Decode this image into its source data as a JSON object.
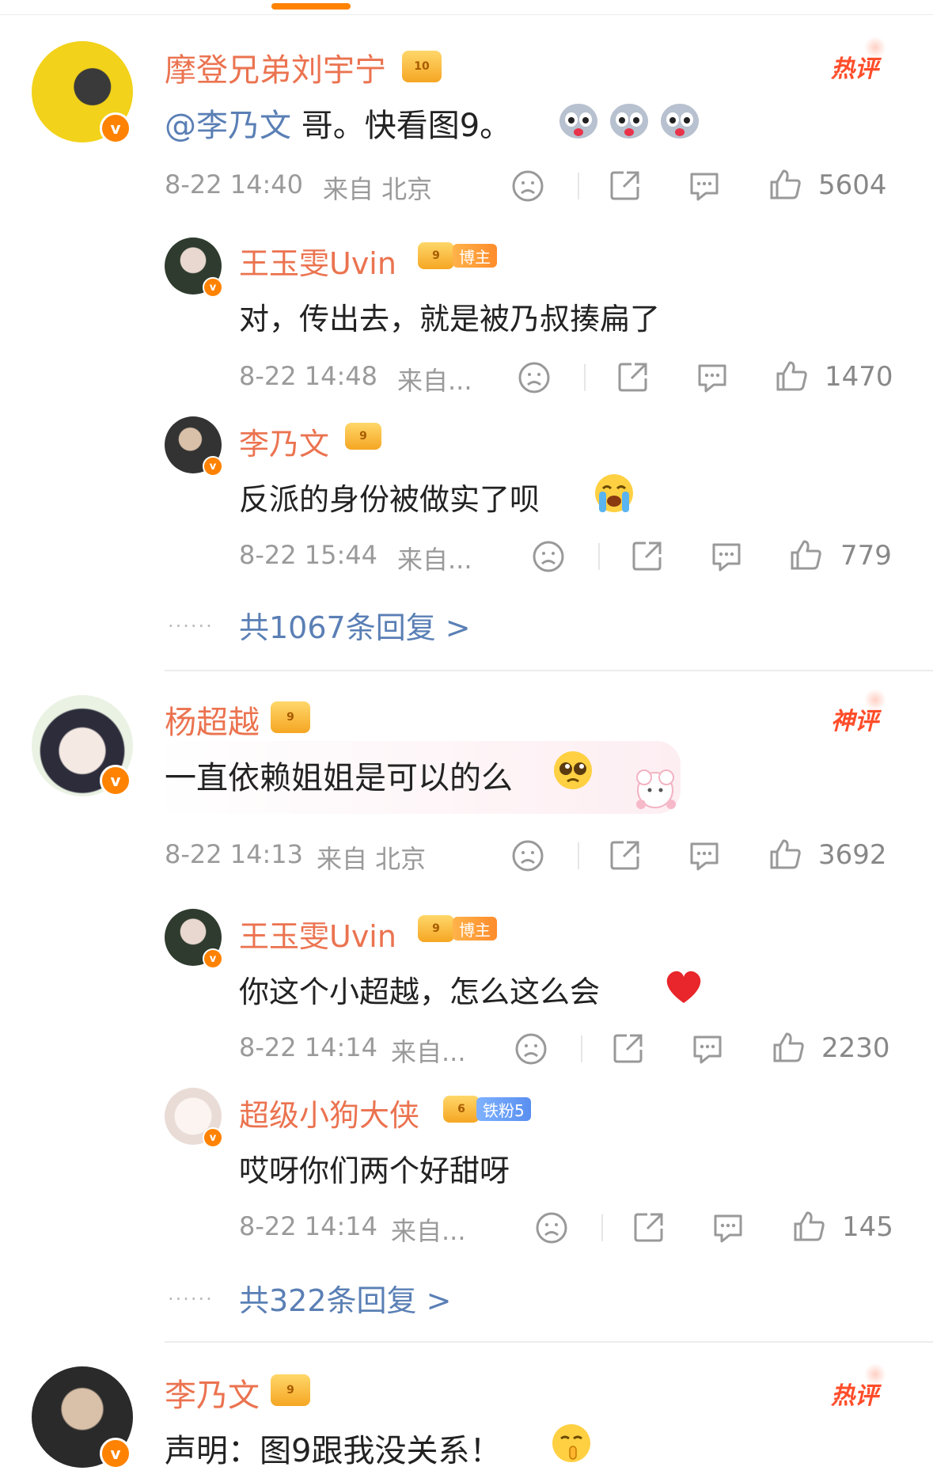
{
  "comments": [
    {
      "author": "摩登兄弟刘宇宁",
      "crown_level": "10",
      "badge": "热评",
      "mention": "@李乃文",
      "text": " 哥。快看图9。",
      "time": "8-22 14:40",
      "location": "来自 北京",
      "likes": "5604",
      "replies": [
        {
          "author": "王玉雯Uvin",
          "crown_level": "9",
          "tag": "博主",
          "text": "对，传出去，就是被乃叔揍扁了",
          "time": "8-22 14:48",
          "location": "来自...",
          "likes": "1470"
        },
        {
          "author": "李乃文",
          "crown_level": "9",
          "text": "反派的身份被做实了呗",
          "time": "8-22 15:44",
          "location": "来自...",
          "likes": "779"
        }
      ],
      "reply_count_text": "共1067条回复 >"
    },
    {
      "author": "杨超越",
      "crown_level": "9",
      "badge": "神评",
      "text": "一直依赖姐姐是可以的么",
      "time": "8-22 14:13",
      "location": "来自 北京",
      "likes": "3692",
      "replies": [
        {
          "author": "王玉雯Uvin",
          "crown_level": "9",
          "tag": "博主",
          "text": "你这个小超越，怎么这么会",
          "time": "8-22 14:14",
          "location": "来自...",
          "likes": "2230"
        },
        {
          "author": "超级小狗大侠",
          "crown_level": "6",
          "tag": "铁粉5",
          "text": "哎呀你们两个好甜呀",
          "time": "8-22 14:14",
          "location": "来自...",
          "likes": "145"
        }
      ],
      "reply_count_text": "共322条回复 >"
    },
    {
      "author": "李乃文",
      "crown_level": "9",
      "badge": "热评",
      "text": "声明：图9跟我没关系！"
    }
  ],
  "dots": "......",
  "verified_mark": "v",
  "colors": {
    "accent": "#ff8200",
    "username": "#eb7350",
    "link": "#5a7fb5",
    "hot": "#ff4d2a",
    "meta": "#9a9a9a"
  },
  "icons": [
    "frown-icon",
    "share-icon",
    "comment-icon",
    "like-icon",
    "crown-icon",
    "verified-icon"
  ]
}
